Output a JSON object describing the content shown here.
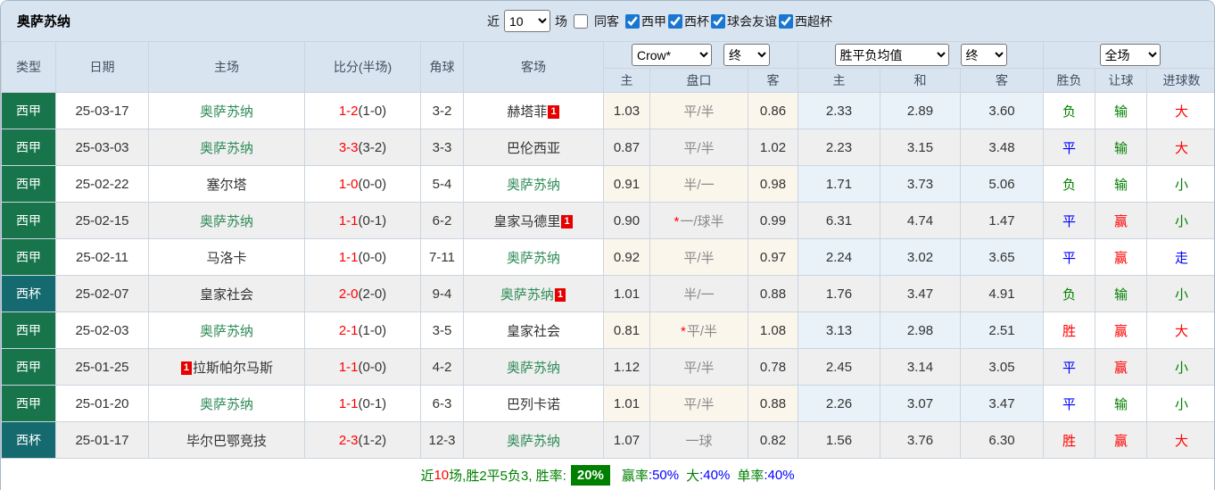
{
  "title": "奥萨苏纳",
  "topbar": {
    "recent_label": "近",
    "recent_count": "10",
    "games_label": "场",
    "same_away_label": "同客",
    "same_away_checked": false,
    "league_filters": [
      {
        "label": "西甲",
        "checked": true
      },
      {
        "label": "西杯",
        "checked": true
      },
      {
        "label": "球会友谊",
        "checked": true
      },
      {
        "label": "西超杯",
        "checked": true
      }
    ]
  },
  "header": {
    "col_type": "类型",
    "col_date": "日期",
    "col_home": "主场",
    "col_score": "比分(半场)",
    "col_corner": "角球",
    "col_away": "客场",
    "asian_company_select": "Crow*",
    "asian_time_select": "终",
    "euro_type_select": "胜平负均值",
    "euro_time_select": "终",
    "period_select": "全场",
    "sub_asian_home": "主",
    "sub_asian_handicap": "盘口",
    "sub_asian_away": "客",
    "sub_euro_home": "主",
    "sub_euro_draw": "和",
    "sub_euro_away": "客",
    "sub_result": "胜负",
    "sub_spread": "让球",
    "sub_goals": "进球数"
  },
  "rows": [
    {
      "league": "西甲",
      "league_class": "liga",
      "date": "25-03-17",
      "home": "奥萨苏纳",
      "home_focus": true,
      "home_badge": "",
      "home_badge_side": "",
      "score": "1-2",
      "half": "(1-0)",
      "corner": "3-2",
      "away": "赫塔菲",
      "away_focus": false,
      "away_badge": "1",
      "away_badge_side": "right",
      "ah_home": "1.03",
      "handicap": "平/半",
      "handicap_star": false,
      "ah_away": "0.86",
      "eu_home": "2.33",
      "eu_draw": "2.89",
      "eu_away": "3.60",
      "result": "负",
      "result_class": "green",
      "spread": "输",
      "spread_class": "green",
      "goals": "大",
      "goals_class": "red"
    },
    {
      "league": "西甲",
      "league_class": "liga",
      "date": "25-03-03",
      "home": "奥萨苏纳",
      "home_focus": true,
      "home_badge": "",
      "home_badge_side": "",
      "score": "3-3",
      "half": "(3-2)",
      "corner": "3-3",
      "away": "巴伦西亚",
      "away_focus": false,
      "away_badge": "",
      "away_badge_side": "",
      "ah_home": "0.87",
      "handicap": "平/半",
      "handicap_star": false,
      "ah_away": "1.02",
      "eu_home": "2.23",
      "eu_draw": "3.15",
      "eu_away": "3.48",
      "result": "平",
      "result_class": "blue",
      "spread": "输",
      "spread_class": "green",
      "goals": "大",
      "goals_class": "red"
    },
    {
      "league": "西甲",
      "league_class": "liga",
      "date": "25-02-22",
      "home": "塞尔塔",
      "home_focus": false,
      "home_badge": "",
      "home_badge_side": "",
      "score": "1-0",
      "half": "(0-0)",
      "corner": "5-4",
      "away": "奥萨苏纳",
      "away_focus": true,
      "away_badge": "",
      "away_badge_side": "",
      "ah_home": "0.91",
      "handicap": "半/一",
      "handicap_star": false,
      "ah_away": "0.98",
      "eu_home": "1.71",
      "eu_draw": "3.73",
      "eu_away": "5.06",
      "result": "负",
      "result_class": "green",
      "spread": "输",
      "spread_class": "green",
      "goals": "小",
      "goals_class": "green"
    },
    {
      "league": "西甲",
      "league_class": "liga",
      "date": "25-02-15",
      "home": "奥萨苏纳",
      "home_focus": true,
      "home_badge": "",
      "home_badge_side": "",
      "score": "1-1",
      "half": "(0-1)",
      "corner": "6-2",
      "away": "皇家马德里",
      "away_focus": false,
      "away_badge": "1",
      "away_badge_side": "right",
      "ah_home": "0.90",
      "handicap": "一/球半",
      "handicap_star": true,
      "ah_away": "0.99",
      "eu_home": "6.31",
      "eu_draw": "4.74",
      "eu_away": "1.47",
      "result": "平",
      "result_class": "blue",
      "spread": "赢",
      "spread_class": "red",
      "goals": "小",
      "goals_class": "green"
    },
    {
      "league": "西甲",
      "league_class": "liga",
      "date": "25-02-11",
      "home": "马洛卡",
      "home_focus": false,
      "home_badge": "",
      "home_badge_side": "",
      "score": "1-1",
      "half": "(0-0)",
      "corner": "7-11",
      "away": "奥萨苏纳",
      "away_focus": true,
      "away_badge": "",
      "away_badge_side": "",
      "ah_home": "0.92",
      "handicap": "平/半",
      "handicap_star": false,
      "ah_away": "0.97",
      "eu_home": "2.24",
      "eu_draw": "3.02",
      "eu_away": "3.65",
      "result": "平",
      "result_class": "blue",
      "spread": "赢",
      "spread_class": "red",
      "goals": "走",
      "goals_class": "blue"
    },
    {
      "league": "西杯",
      "league_class": "copa",
      "date": "25-02-07",
      "home": "皇家社会",
      "home_focus": false,
      "home_badge": "",
      "home_badge_side": "",
      "score": "2-0",
      "half": "(2-0)",
      "corner": "9-4",
      "away": "奥萨苏纳",
      "away_focus": true,
      "away_badge": "1",
      "away_badge_side": "right",
      "ah_home": "1.01",
      "handicap": "半/一",
      "handicap_star": false,
      "ah_away": "0.88",
      "eu_home": "1.76",
      "eu_draw": "3.47",
      "eu_away": "4.91",
      "result": "负",
      "result_class": "green",
      "spread": "输",
      "spread_class": "green",
      "goals": "小",
      "goals_class": "green"
    },
    {
      "league": "西甲",
      "league_class": "liga",
      "date": "25-02-03",
      "home": "奥萨苏纳",
      "home_focus": true,
      "home_badge": "",
      "home_badge_side": "",
      "score": "2-1",
      "half": "(1-0)",
      "corner": "3-5",
      "away": "皇家社会",
      "away_focus": false,
      "away_badge": "",
      "away_badge_side": "",
      "ah_home": "0.81",
      "handicap": "平/半",
      "handicap_star": true,
      "ah_away": "1.08",
      "eu_home": "3.13",
      "eu_draw": "2.98",
      "eu_away": "2.51",
      "result": "胜",
      "result_class": "red",
      "spread": "赢",
      "spread_class": "red",
      "goals": "大",
      "goals_class": "red"
    },
    {
      "league": "西甲",
      "league_class": "liga",
      "date": "25-01-25",
      "home": "拉斯帕尔马斯",
      "home_focus": false,
      "home_badge": "1",
      "home_badge_side": "left",
      "score": "1-1",
      "half": "(0-0)",
      "corner": "4-2",
      "away": "奥萨苏纳",
      "away_focus": true,
      "away_badge": "",
      "away_badge_side": "",
      "ah_home": "1.12",
      "handicap": "平/半",
      "handicap_star": false,
      "ah_away": "0.78",
      "eu_home": "2.45",
      "eu_draw": "3.14",
      "eu_away": "3.05",
      "result": "平",
      "result_class": "blue",
      "spread": "赢",
      "spread_class": "red",
      "goals": "小",
      "goals_class": "green"
    },
    {
      "league": "西甲",
      "league_class": "liga",
      "date": "25-01-20",
      "home": "奥萨苏纳",
      "home_focus": true,
      "home_badge": "",
      "home_badge_side": "",
      "score": "1-1",
      "half": "(0-1)",
      "corner": "6-3",
      "away": "巴列卡诺",
      "away_focus": false,
      "away_badge": "",
      "away_badge_side": "",
      "ah_home": "1.01",
      "handicap": "平/半",
      "handicap_star": false,
      "ah_away": "0.88",
      "eu_home": "2.26",
      "eu_draw": "3.07",
      "eu_away": "3.47",
      "result": "平",
      "result_class": "blue",
      "spread": "输",
      "spread_class": "green",
      "goals": "小",
      "goals_class": "green"
    },
    {
      "league": "西杯",
      "league_class": "copa",
      "date": "25-01-17",
      "home": "毕尔巴鄂竞技",
      "home_focus": false,
      "home_badge": "",
      "home_badge_side": "",
      "score": "2-3",
      "half": "(1-2)",
      "corner": "12-3",
      "away": "奥萨苏纳",
      "away_focus": true,
      "away_badge": "",
      "away_badge_side": "",
      "ah_home": "1.07",
      "handicap": "一球",
      "handicap_star": false,
      "ah_away": "0.82",
      "eu_home": "1.56",
      "eu_draw": "3.76",
      "eu_away": "6.30",
      "result": "胜",
      "result_class": "red",
      "spread": "赢",
      "spread_class": "red",
      "goals": "大",
      "goals_class": "red"
    }
  ],
  "footer": {
    "recent_prefix": "近",
    "recent_num": "10",
    "summary": "场,胜2平5负3, 胜率:",
    "win_rate": "20%",
    "handicap_label": "赢率",
    "handicap_value": ":50%",
    "big_label": "大",
    "big_value": ":40%",
    "single_label": "单率",
    "single_value": ":40%"
  },
  "colors": {
    "liga_green": "#17744b",
    "copa_teal": "#156a70",
    "focus_team_green": "#2e8b57",
    "win_red": "#ff0000",
    "draw_blue": "#0000ff",
    "lose_green": "#008000",
    "badge_red": "#e60000",
    "header_bg": "#d9e4f1",
    "asian_col_bg": "#fbf6ec",
    "euro_col_bg": "#e8f2f8",
    "rate_badge_bg": "#008000"
  }
}
